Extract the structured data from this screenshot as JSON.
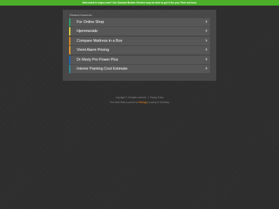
{
  "banner": {
    "text": "Interested in icapo.com? Our Domain Broker Service may be able to get it for you. Find out how."
  },
  "panel": {
    "title": "Related Searches",
    "items": [
      {
        "label": "For Online Shop",
        "color": "#2aa36a"
      },
      {
        "label": "Hjemmeside",
        "color": "#e3d23a"
      },
      {
        "label": "Compare Mattress in a Box",
        "color": "#e08a1f"
      },
      {
        "label": "Vivint Alarm Pricing",
        "color": "#f09a2a"
      },
      {
        "label": "Dr Marty Pro Power Plus",
        "color": "#1e66b8"
      },
      {
        "label": "Interior Painting Cost Estimate",
        "color": "#2a8a9a"
      }
    ]
  },
  "footer": {
    "copyright": "Copyright ©.  All rights reserved.",
    "separator": "|",
    "privacy": "Privacy Policy",
    "parked_pre": "Free Web Stats & parked by ",
    "parked_brand": "Parklogic",
    "parked_post": " courtesy of GoDaddy"
  },
  "colors": {
    "banner": "#4caf2a",
    "background": "#2e2e2e",
    "panel": "#484848",
    "item": "#575757"
  }
}
